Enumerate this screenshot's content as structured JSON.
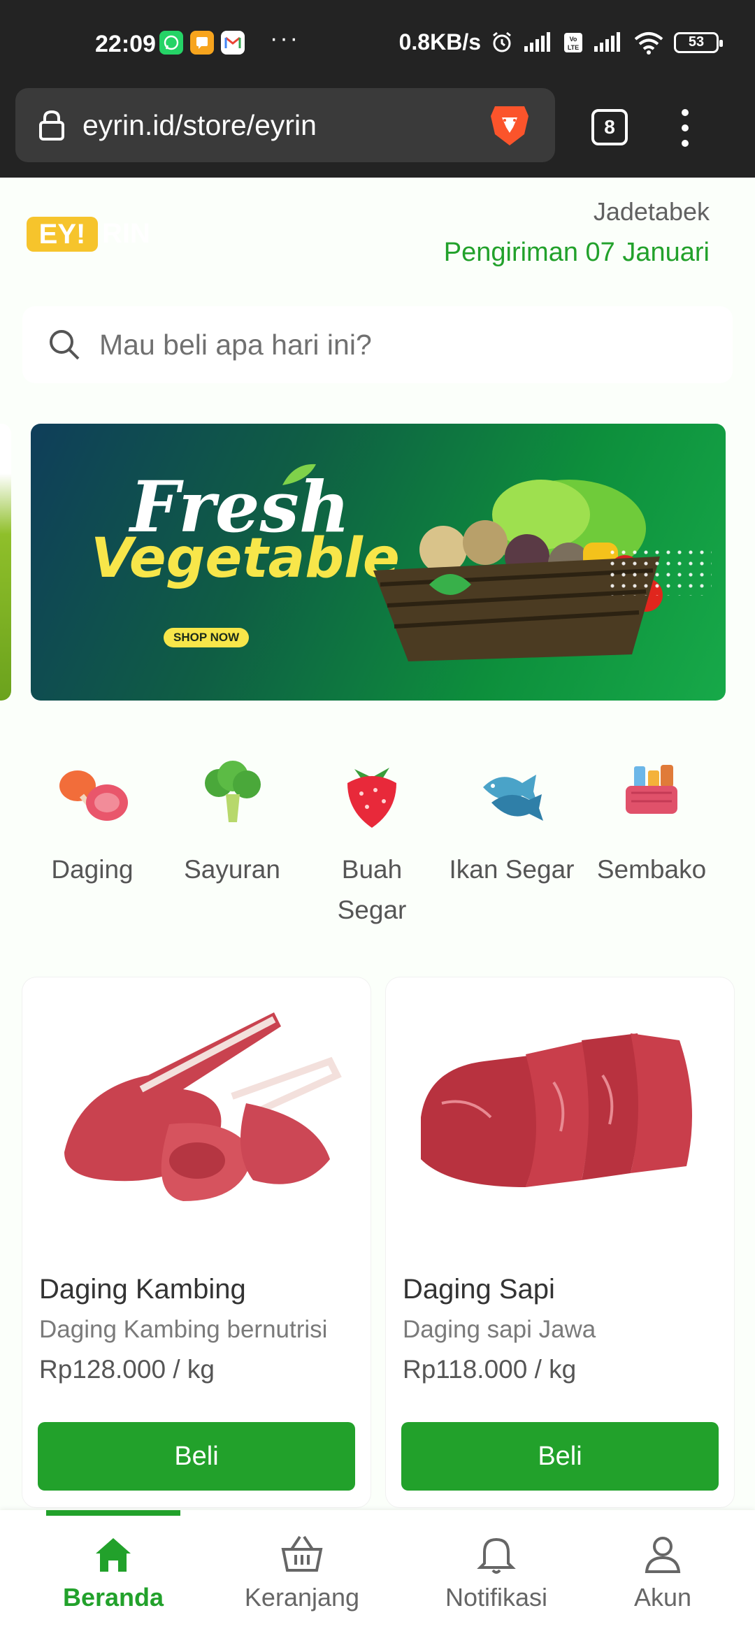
{
  "status_bar": {
    "time": "22:09",
    "network_speed": "0.8KB/s",
    "battery": "53",
    "more": "···",
    "apps": [
      {
        "name": "whatsapp-icon",
        "color": "#25d366"
      },
      {
        "name": "messages-icon",
        "color": "#f7a41d"
      },
      {
        "name": "gmail-icon",
        "color": "#ffffff"
      }
    ]
  },
  "browser": {
    "url": "eyrin.id/store/eyrin",
    "tab_count": "8"
  },
  "header": {
    "logo": "EY!",
    "logo_suffix": "RIN",
    "region": "Jadetabek",
    "delivery": "Pengiriman 07 Januari"
  },
  "search": {
    "placeholder": "Mau beli apa hari ini?"
  },
  "banner": {
    "line1": "Fresh",
    "line2": "Vegetable",
    "cta": "SHOP NOW"
  },
  "categories": [
    {
      "label": "Daging",
      "icon": "meat-icon"
    },
    {
      "label": "Sayuran",
      "icon": "broccoli-icon"
    },
    {
      "label": "Buah Segar",
      "icon": "strawberry-icon"
    },
    {
      "label": "Ikan Segar",
      "icon": "fish-icon"
    },
    {
      "label": "Sembako",
      "icon": "grocery-basket-icon"
    }
  ],
  "products": [
    {
      "name": "Daging Kambing",
      "description": "Daging Kambing bernutrisi",
      "price": "Rp128.000 / kg",
      "button": "Beli"
    },
    {
      "name": "Daging Sapi",
      "description": "Daging sapi Jawa",
      "price": "Rp118.000 / kg",
      "button": "Beli"
    }
  ],
  "bottom_nav": [
    {
      "label": "Beranda",
      "icon": "home-icon",
      "active": true
    },
    {
      "label": "Keranjang",
      "icon": "basket-icon",
      "active": false
    },
    {
      "label": "Notifikasi",
      "icon": "bell-icon",
      "active": false
    },
    {
      "label": "Akun",
      "icon": "user-icon",
      "active": false
    }
  ],
  "colors": {
    "accent": "#22a12b",
    "logo": "#f6c42c",
    "chrome": "#232323",
    "background": "#fbfffa"
  }
}
